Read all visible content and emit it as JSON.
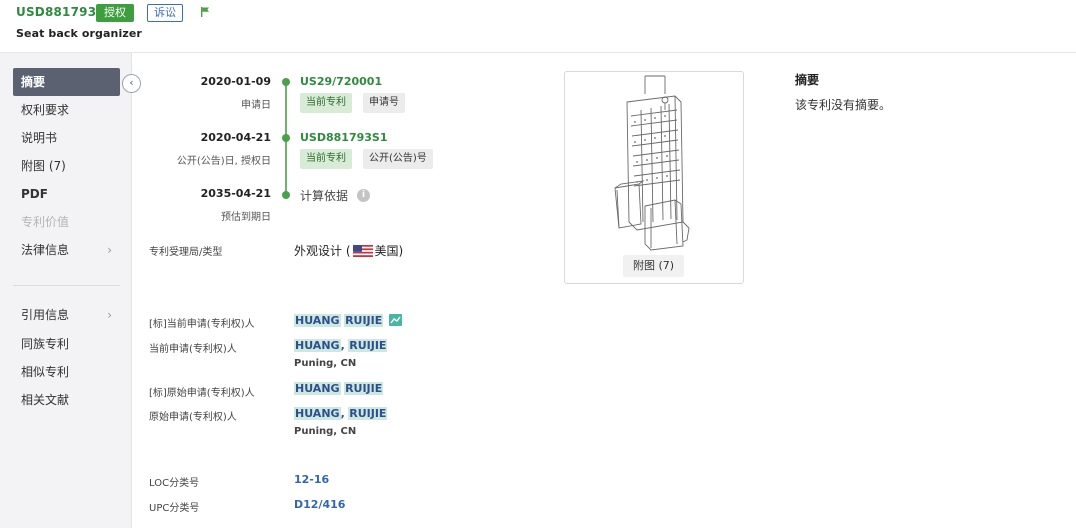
{
  "header": {
    "patent_id": "USD881793S1",
    "status_badge": "授权",
    "litigation_badge": "诉讼",
    "title": "Seat back organizer"
  },
  "sidebar": {
    "items": [
      {
        "label": "摘要",
        "state": "active"
      },
      {
        "label": "权利要求",
        "state": "normal"
      },
      {
        "label": "说明书",
        "state": "normal"
      },
      {
        "label": "附图 (7)",
        "state": "normal"
      },
      {
        "label": "PDF",
        "state": "normal"
      },
      {
        "label": "专利价值",
        "state": "disabled"
      },
      {
        "label": "法律信息",
        "state": "normal",
        "chevron": true
      },
      {
        "label": "引用信息",
        "state": "normal",
        "chevron": true
      },
      {
        "label": "同族专利",
        "state": "normal"
      },
      {
        "label": "相似专利",
        "state": "normal"
      },
      {
        "label": "相关文献",
        "state": "normal"
      }
    ]
  },
  "timeline": [
    {
      "date": "2020-01-09",
      "date_label": "申请日",
      "number": "US29/720001",
      "tags": [
        "当前专利",
        "申请号"
      ]
    },
    {
      "date": "2020-04-21",
      "date_label": "公开(公告)日, 授权日",
      "number": "USD881793S1",
      "tags": [
        "当前专利",
        "公开(公告)号"
      ]
    },
    {
      "date": "2035-04-21",
      "date_label": "预估到期日",
      "calc_label": "计算依据"
    }
  ],
  "office": {
    "label": "专利受理局/类型",
    "value_prefix": "外观设计 (",
    "country": "美国",
    "value_suffix": ")"
  },
  "parties": {
    "std_current_label": "[标]当前申请(专利权)人",
    "std_current_name_1": "HUANG",
    "std_current_name_2": "RUIJIE",
    "current_label": "当前申请(专利权)人",
    "current_name_1": "HUANG",
    "current_name_2": "RUIJIE",
    "current_location": "Puning, CN",
    "std_original_label": "[标]原始申请(专利权)人",
    "std_original_name_1": "HUANG",
    "std_original_name_2": "RUIJIE",
    "original_label": "原始申请(专利权)人",
    "original_name_1": "HUANG",
    "original_name_2": "RUIJIE",
    "original_location": "Puning, CN"
  },
  "classification": {
    "loc_label": "LOC分类号",
    "loc_value": "12-16",
    "upc_label": "UPC分类号",
    "upc_value": "D12/416"
  },
  "figure": {
    "caption": "附图 (7)"
  },
  "abstract": {
    "title": "摘要",
    "text": "该专利没有摘要。"
  },
  "colors": {
    "brand_green": "#3d9e3d",
    "link_blue": "#3366b0",
    "sidebar_active": "#5b6170"
  }
}
